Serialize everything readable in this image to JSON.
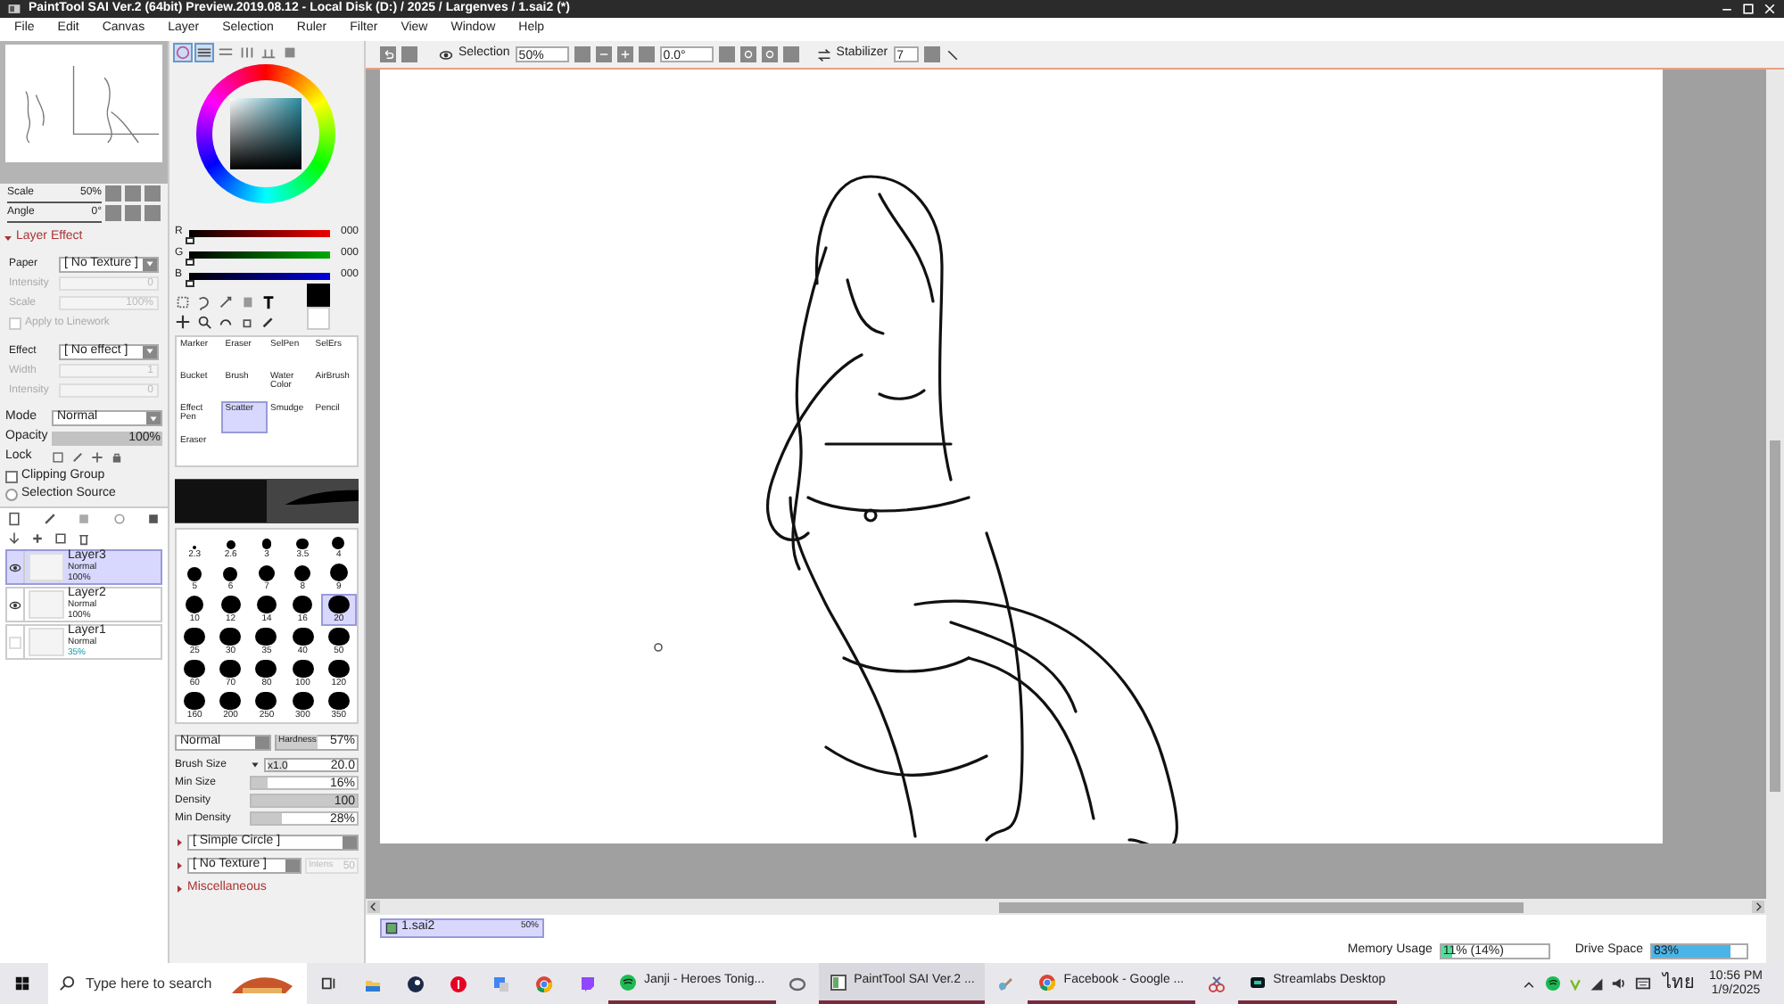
{
  "window": {
    "title": "PaintTool SAI Ver.2 (64bit) Preview.2019.08.12 - Local Disk (D:) / 2025 / Largenves / 1.sai2 (*)"
  },
  "menu": [
    "File",
    "Edit",
    "Canvas",
    "Layer",
    "Selection",
    "Ruler",
    "Filter",
    "View",
    "Window",
    "Help"
  ],
  "navigator": {
    "scale_label": "Scale",
    "scale_value": "50%",
    "angle_label": "Angle",
    "angle_value": "0°"
  },
  "layer_effect": {
    "title": "Layer Effect",
    "expanded": true,
    "rows": [
      {
        "kind": "select",
        "label": "Paper",
        "value": "[ No Texture ]",
        "disabled": false
      },
      {
        "kind": "field",
        "label": "Intensity",
        "value": "0",
        "disabled": true
      },
      {
        "kind": "field",
        "label": "Scale",
        "value": "100%",
        "disabled": true
      },
      {
        "kind": "check",
        "label": "Apply to Linework",
        "checked": false,
        "disabled": true
      },
      {
        "kind": "select",
        "label": "Effect",
        "value": "[ No effect ]",
        "disabled": false
      },
      {
        "kind": "field",
        "label": "Width",
        "value": "1",
        "disabled": true
      },
      {
        "kind": "field",
        "label": "Intensity",
        "value": "0",
        "disabled": true
      }
    ]
  },
  "layer_props": {
    "mode_label": "Mode",
    "mode": "Normal",
    "opacity_label": "Opacity",
    "opacity": {
      "value": "100%",
      "level": 1
    },
    "lock_label": "Lock",
    "clipping_group": {
      "label": "Clipping Group",
      "checked": false
    },
    "selection_source": {
      "label": "Selection Source",
      "selected": false
    }
  },
  "layers": [
    {
      "name": "Layer3",
      "mode": "Normal",
      "opacity": "100%",
      "visible": true,
      "selected": true
    },
    {
      "name": "Layer2",
      "mode": "Normal",
      "opacity": "100%",
      "visible": true,
      "selected": false
    },
    {
      "name": "Layer1",
      "mode": "Normal",
      "opacity": "35%",
      "visible": false,
      "selected": false
    }
  ],
  "color": {
    "sliders": [
      {
        "label": "R",
        "value": "000",
        "level": 0
      },
      {
        "label": "G",
        "value": "000",
        "level": 0
      },
      {
        "label": "B",
        "value": "000",
        "level": 0
      }
    ]
  },
  "tools": [
    {
      "label": "Marker",
      "selected": false
    },
    {
      "label": "Eraser",
      "selected": false
    },
    {
      "label": "SelPen",
      "selected": false
    },
    {
      "label": "SelErs",
      "selected": false
    },
    {
      "label": "Bucket",
      "selected": false
    },
    {
      "label": "Brush",
      "selected": false
    },
    {
      "label": "Water Color",
      "selected": false
    },
    {
      "label": "AirBrush",
      "selected": false
    },
    {
      "label": "Effect Pen",
      "selected": false
    },
    {
      "label": "Scatter",
      "selected": true
    },
    {
      "label": "Smudge",
      "selected": false
    },
    {
      "label": "Pencil",
      "selected": false
    },
    {
      "label": "Eraser",
      "selected": false
    }
  ],
  "brush_sizes": [
    {
      "label": "2.3",
      "selected": false
    },
    {
      "label": "2.6",
      "selected": false
    },
    {
      "label": "3",
      "selected": false
    },
    {
      "label": "3.5",
      "selected": false
    },
    {
      "label": "4",
      "selected": false
    },
    {
      "label": "5",
      "selected": false
    },
    {
      "label": "6",
      "selected": false
    },
    {
      "label": "7",
      "selected": false
    },
    {
      "label": "8",
      "selected": false
    },
    {
      "label": "9",
      "selected": false
    },
    {
      "label": "10",
      "selected": false
    },
    {
      "label": "12",
      "selected": false
    },
    {
      "label": "14",
      "selected": false
    },
    {
      "label": "16",
      "selected": false
    },
    {
      "label": "20",
      "selected": true
    },
    {
      "label": "25",
      "selected": false
    },
    {
      "label": "30",
      "selected": false
    },
    {
      "label": "35",
      "selected": false
    },
    {
      "label": "40",
      "selected": false
    },
    {
      "label": "50",
      "selected": false
    },
    {
      "label": "60",
      "selected": false
    },
    {
      "label": "70",
      "selected": false
    },
    {
      "label": "80",
      "selected": false
    },
    {
      "label": "100",
      "selected": false
    },
    {
      "label": "120",
      "selected": false
    },
    {
      "label": "160",
      "selected": false
    },
    {
      "label": "200",
      "selected": false
    },
    {
      "label": "250",
      "selected": false
    },
    {
      "label": "300",
      "selected": false
    },
    {
      "label": "350",
      "selected": false
    }
  ],
  "brush_settings": {
    "blend": "Normal",
    "hardness_label": "Hardness",
    "hardness": "57%",
    "rows": [
      {
        "kind": "size",
        "label": "Brush Size",
        "multiplier": "x1.0",
        "value": "20.0"
      },
      {
        "kind": "slider",
        "label": "Min Size",
        "value": "16%",
        "level": 0.16
      },
      {
        "kind": "slider",
        "label": "Density",
        "value": "100",
        "level": 1
      },
      {
        "kind": "slider",
        "label": "Min Density",
        "value": "28%",
        "level": 0.28
      }
    ],
    "shape": "[ Simple Circle ]",
    "texture": "[ No Texture ]",
    "texture_intensity": "Intens",
    "texture_intensity_value": "50",
    "misc": "Miscellaneous"
  },
  "toolbar": {
    "selection_label": "Selection",
    "zoom": "50%",
    "angle": "0.0°",
    "stabilizer_label": "Stabilizer",
    "stabilizer": "7"
  },
  "document_tabs": [
    {
      "name": "1.sai2",
      "zoom": "50%",
      "selected": true
    }
  ],
  "status_bar": {
    "memory_label": "Memory Usage",
    "memory": {
      "value": "11% (14%)",
      "level": 0.11
    },
    "drive_label": "Drive Space",
    "drive": {
      "value": "83%",
      "level": 0.83
    }
  },
  "taskbar": {
    "search_placeholder": "Type here to search",
    "apps": [
      {
        "kind": "icon"
      },
      {
        "kind": "icon"
      },
      {
        "kind": "icon"
      },
      {
        "kind": "icon"
      },
      {
        "kind": "icon"
      },
      {
        "kind": "icon"
      },
      {
        "kind": "window",
        "label": "Janji - Heroes Tonig...",
        "selected": false
      },
      {
        "kind": "icon"
      },
      {
        "kind": "window",
        "label": "PaintTool SAI Ver.2 ...",
        "selected": true
      },
      {
        "kind": "icon"
      },
      {
        "kind": "window",
        "label": "Facebook - Google ...",
        "selected": false
      },
      {
        "kind": "icon"
      },
      {
        "kind": "window",
        "label": "Streamlabs Desktop",
        "selected": false
      }
    ],
    "language": "ไทย",
    "time": "10:56 PM",
    "date": "1/9/2025"
  }
}
